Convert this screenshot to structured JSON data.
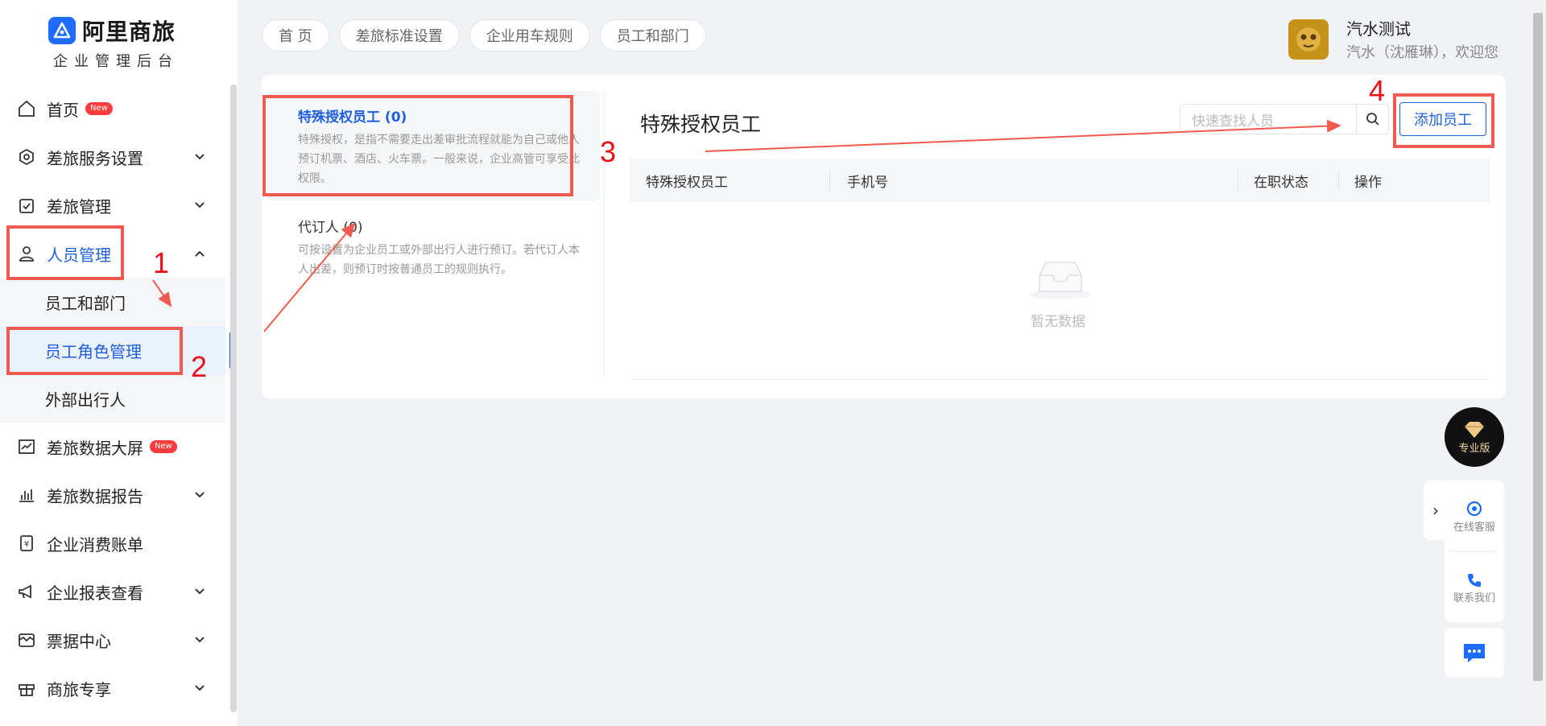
{
  "logo": {
    "title": "阿里商旅",
    "subtitle": "企业管理后台"
  },
  "sidebar": {
    "items": [
      {
        "label": "首页",
        "badge": "New"
      },
      {
        "label": "差旅服务设置"
      },
      {
        "label": "差旅管理"
      },
      {
        "label": "人员管理"
      },
      {
        "label": "员工和部门"
      },
      {
        "label": "员工角色管理"
      },
      {
        "label": "外部出行人"
      },
      {
        "label": "差旅数据大屏",
        "badge": "New"
      },
      {
        "label": "差旅数据报告"
      },
      {
        "label": "企业消费账单"
      },
      {
        "label": "企业报表查看"
      },
      {
        "label": "票据中心"
      },
      {
        "label": "商旅专享"
      }
    ]
  },
  "breadcrumbs": [
    "首 页",
    "差旅标准设置",
    "企业用车规则",
    "员工和部门"
  ],
  "user": {
    "name": "汽水测试",
    "welcome": "汽水（沈雁琳），欢迎您"
  },
  "roles": [
    {
      "title": "特殊授权员工 (0)",
      "desc": "特殊授权，是指不需要走出差审批流程就能为自己或他人预订机票、酒店、火车票。一般来说，企业高管可享受此权限。"
    },
    {
      "title": "代订人 (0)",
      "desc": "可按设置为企业员工或外部出行人进行预订。若代订人本人出差，则预订时按普通员工的规则执行。"
    }
  ],
  "panel": {
    "title": "特殊授权员工",
    "search_placeholder": "快速查找人员",
    "add_label": "添加员工",
    "columns": [
      "特殊授权员工",
      "手机号",
      "在职状态",
      "操作"
    ],
    "empty_text": "暂无数据"
  },
  "annotations": [
    "1",
    "2",
    "3",
    "4"
  ],
  "floating": {
    "pro": "专业版",
    "service": "在线客服",
    "contact": "联系我们"
  },
  "colors": {
    "primary": "#1e5fe0",
    "annotation": "#f05a4f"
  }
}
